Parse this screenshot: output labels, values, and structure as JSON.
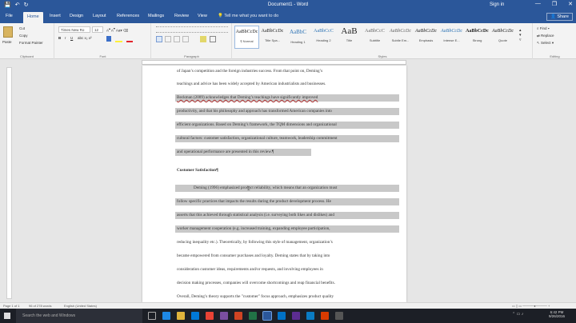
{
  "window": {
    "title": "Document1 - Word",
    "signin": "Sign in",
    "min": "—",
    "max": "❐",
    "close": "✕"
  },
  "qat": {
    "save": "💾",
    "undo": "↶",
    "redo": "↻"
  },
  "tabs": [
    "File",
    "Home",
    "Insert",
    "Design",
    "Layout",
    "References",
    "Mailings",
    "Review",
    "View"
  ],
  "tell_me": "💡 Tell me what you want to do",
  "share": "👤 Share",
  "clipboard": {
    "paste": "Paste",
    "cut": "Cut",
    "copy": "Copy",
    "format_painter": "Format Painter",
    "label": "Clipboard"
  },
  "font": {
    "name": "Times New Ro",
    "size": "12",
    "label": "Font"
  },
  "paragraph": {
    "label": "Paragraph"
  },
  "styles": {
    "label": "Styles",
    "items": [
      {
        "preview": "AaBbCcDc",
        "name": "¶ Normal"
      },
      {
        "preview": "AaBbCcDc",
        "name": "Title Spa..."
      },
      {
        "preview": "AaBbC",
        "name": "Heading 1"
      },
      {
        "preview": "AaBbCcC",
        "name": "Heading 2"
      },
      {
        "preview": "AaB",
        "name": "Title"
      },
      {
        "preview": "AaBbCcC",
        "name": "Subtitle"
      },
      {
        "preview": "AaBbCcDc",
        "name": "Subtle Em..."
      },
      {
        "preview": "AaBbCcDc",
        "name": "Emphasis"
      },
      {
        "preview": "AaBbCcDc",
        "name": "Intense E..."
      },
      {
        "preview": "AaBbCcDc",
        "name": "Strong"
      },
      {
        "preview": "AaBbCcDc",
        "name": "Quote"
      }
    ]
  },
  "editing": {
    "find": "Find",
    "replace": "Replace",
    "select": "Select",
    "label": "Editing"
  },
  "document": {
    "lines": [
      "of Japan’s competition and the foreign industries success. From that point on, Deming’s",
      "teachings and advice has been widely accepted by American industrialists and businesses.",
      "Beckman (2009) acknowledges that Deming’s teachings have significantly improved",
      "productivity, and that his philosophy and approach has transformed American companies into",
      "efficient organizations. Based on Deming’s framework, the TQM dimensions and organizational",
      "cultural factors: customer satisfaction, organizational culture, teamwork, leadership commitment",
      "and operational performance are presented in this review.¶",
      "Customer Satisfaction¶",
      "Deming (1996) emphasized product reliability, which means that an organization must",
      "follow specific practices that impacts the results during the product development process. He",
      "asserts that this achieved through statistical analysis (i.e. surveying both likes and dislikes) and",
      "worker management cooperation (e.g. increased training, expanding employee participation,",
      "reducing inequality etc.). Theoretically, by following this style of management, organization’s",
      "became empowered from consumer purchases and loyalty. Deming states that by taking into",
      "consideration customer ideas, requirements and/or requests, and involving employees in",
      "decision making processes, companies will overcome shortcomings and reap financial benefits.",
      "Overall, Deming’s theory supports the \"customer\" focus approach, emphasizes product quality"
    ]
  },
  "status": {
    "page": "Page 1 of 1",
    "words": "96 of 278 words",
    "language": "English (United States)"
  },
  "taskbar": {
    "search": "Search the web and Windows",
    "time": "6:42 PM",
    "date": "9/26/2016"
  }
}
